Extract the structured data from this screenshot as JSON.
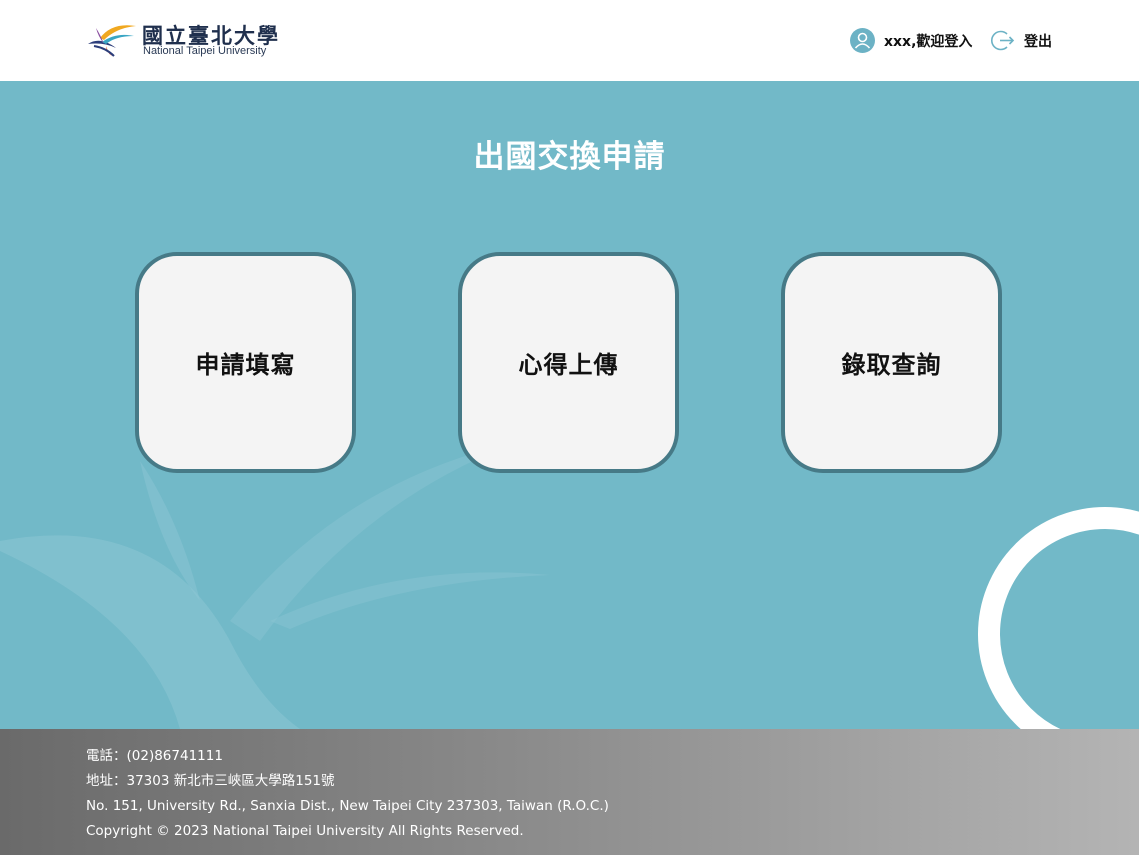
{
  "header": {
    "logo_zh": "國立臺北大學",
    "logo_en": "National Taipei University",
    "user_label": "xxx,歡迎登入",
    "logout_label": "登出"
  },
  "main": {
    "title": "出國交換申請",
    "cards": [
      {
        "label": "申請填寫"
      },
      {
        "label": "心得上傳"
      },
      {
        "label": "錄取查詢"
      }
    ]
  },
  "footer": {
    "phone": "電話：(02)86741111",
    "address_zh": "地址：37303 新北市三峽區大學路151號",
    "address_en": "No. 151, University Rd., Sanxia Dist., New Taipei City 237303, Taiwan (R.O.C.)",
    "copyright": "Copyright © 2023 National Taipei University All Rights Reserved."
  },
  "colors": {
    "background": "#72b9c8",
    "card_border": "#467a87",
    "card_fill": "#f4f4f4",
    "accent": "#6cb2c5"
  },
  "icons": {
    "user": "user-icon",
    "logout": "logout-icon",
    "logo": "ntpu-logo-icon"
  }
}
